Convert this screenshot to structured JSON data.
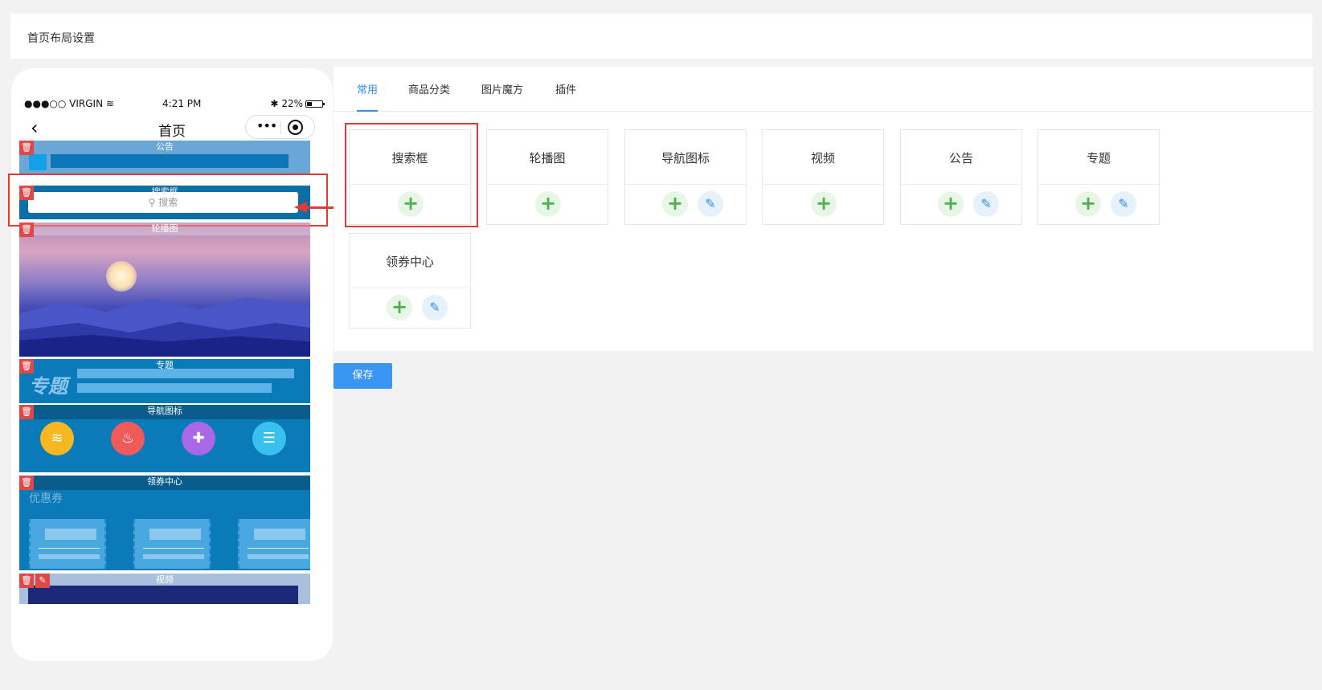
{
  "page": {
    "title": "首页布局设置"
  },
  "phone": {
    "status": {
      "carrier": "●●●○○ VIRGIN",
      "time": "4:21 PM",
      "battery": "22%"
    },
    "nav_title": "首页",
    "blocks": {
      "notice": "公告",
      "search": "搜索框",
      "search_placeholder": "搜索",
      "banner": "轮播图",
      "topic": "专题",
      "topic_logo": "专题",
      "nav_icons": "导航图标",
      "coupon": "领券中心",
      "coupon_text": "优惠券",
      "video": "视频"
    }
  },
  "tabs": [
    {
      "label": "常用",
      "active": true
    },
    {
      "label": "商品分类",
      "active": false
    },
    {
      "label": "图片魔方",
      "active": false
    },
    {
      "label": "插件",
      "active": false
    }
  ],
  "components": [
    {
      "name": "搜索框",
      "editable": false
    },
    {
      "name": "轮播图",
      "editable": false
    },
    {
      "name": "导航图标",
      "editable": true
    },
    {
      "name": "视频",
      "editable": false
    },
    {
      "name": "公告",
      "editable": true
    },
    {
      "name": "专题",
      "editable": true
    },
    {
      "name": "领券中心",
      "editable": true
    }
  ],
  "save_label": "保存",
  "colors": {
    "accent": "#2f8fe8",
    "highlight": "#e53935",
    "add": "#4cb04c"
  }
}
